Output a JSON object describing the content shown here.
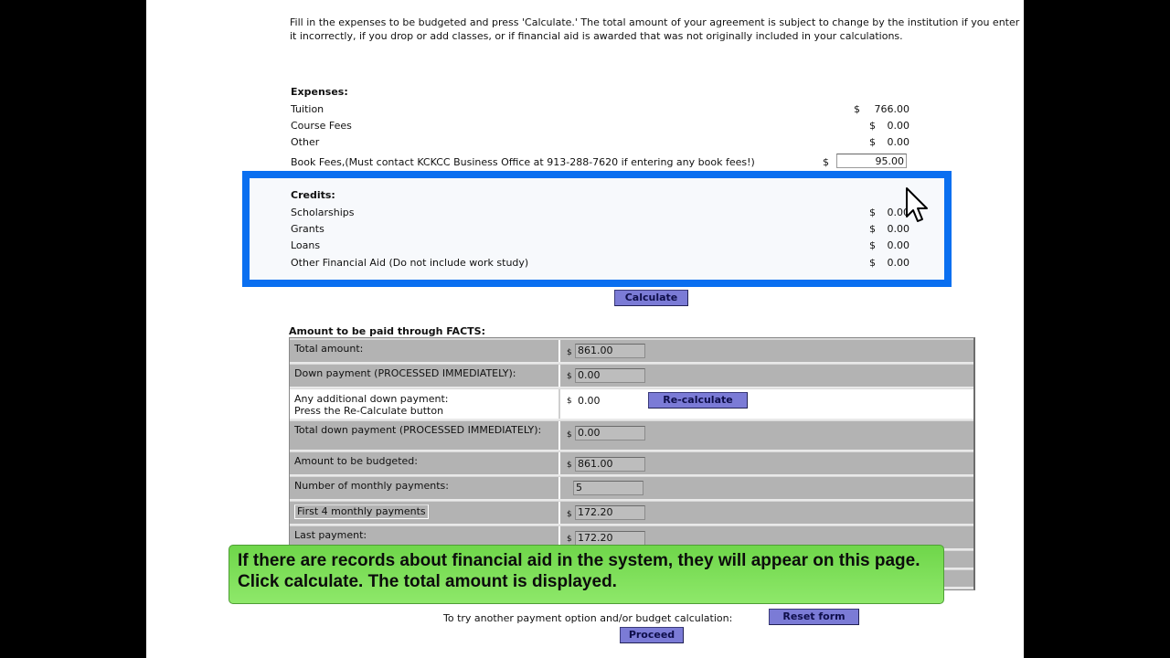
{
  "intro": "Fill in the expenses to be budgeted and press 'Calculate.' The total amount of your agreement is subject to change by the institution if you enter it incorrectly, if you drop or add classes, or if financial aid is awarded that was not originally included in your calculations.",
  "expenses": {
    "heading": "Expenses:",
    "items": [
      {
        "label": "Tuition",
        "currency": "$",
        "amount": "766.00"
      },
      {
        "label": "Course Fees",
        "currency": "$",
        "amount": "0.00"
      },
      {
        "label": "Other",
        "currency": "$",
        "amount": "0.00"
      }
    ],
    "book_fees": {
      "label": "Book Fees,(Must contact KCKCC Business Office at 913-288-7620 if entering any book fees!)",
      "currency": "$",
      "value": "95.00"
    }
  },
  "credits": {
    "heading": "Credits:",
    "items": [
      {
        "label": "Scholarships",
        "currency": "$",
        "amount": "0.00"
      },
      {
        "label": "Grants",
        "currency": "$",
        "amount": "0.00"
      },
      {
        "label": "Loans",
        "currency": "$",
        "amount": "0.00"
      },
      {
        "label": "Other Financial Aid (Do not include work study)",
        "currency": "$",
        "amount": "0.00"
      }
    ]
  },
  "calculate_label": "Calculate",
  "facts": {
    "title": "Amount to be paid through FACTS:",
    "rows": [
      {
        "label": "Total amount:",
        "currency": "$",
        "value": "861.00"
      },
      {
        "label": "Down payment (PROCESSED IMMEDIATELY):",
        "currency": "$",
        "value": "0.00"
      },
      {
        "label": "Any additional down payment:",
        "sublabel": "Press the Re-Calculate button",
        "currency": "$",
        "value": "0.00",
        "button": "Re-calculate"
      },
      {
        "label": "Total down payment (PROCESSED IMMEDIATELY):",
        "currency": "$",
        "value": "0.00"
      },
      {
        "label": "Amount to be budgeted:",
        "currency": "$",
        "value": "861.00"
      },
      {
        "label": "Number of monthly payments:",
        "value": "5"
      },
      {
        "label": "First 4 monthly payments",
        "currency": "$",
        "value": "172.20"
      },
      {
        "label": "Last payment:",
        "currency": "$",
        "value": "172.20"
      }
    ]
  },
  "banner_text": "If there are records about financial aid in the system, they will appear on this page. Click calculate. The total amount is displayed.",
  "reset_prompt": "To try another payment option and/or budget calculation:",
  "reset_label": "Reset form",
  "proceed_label": "Proceed",
  "colors": {
    "highlight_border": "#0a6ff0",
    "button_bg": "#7b7bd6",
    "banner_bg": "#7ddc55",
    "table_row_bg": "#b3b3b3"
  },
  "cursor_icon": "arrow-pointer-icon"
}
